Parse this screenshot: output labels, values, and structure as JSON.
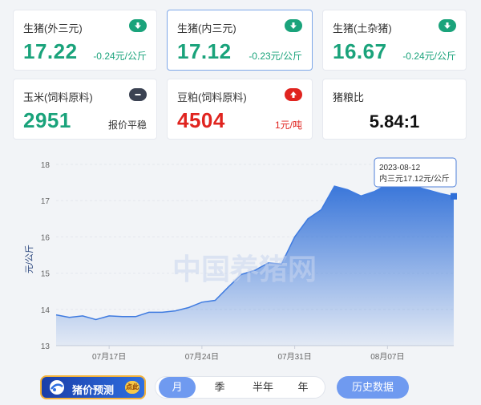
{
  "cards": [
    {
      "title": "生猪(外三元)",
      "value": "17.22",
      "change": "-0.24元/公斤",
      "trend": "down"
    },
    {
      "title": "生猪(内三元)",
      "value": "17.12",
      "change": "-0.23元/公斤",
      "trend": "down"
    },
    {
      "title": "生猪(土杂猪)",
      "value": "16.67",
      "change": "-0.24元/公斤",
      "trend": "down"
    },
    {
      "title": "玉米(饲料原料)",
      "value": "2951",
      "change": "报价平稳",
      "trend": "flat"
    },
    {
      "title": "豆粕(饲料原料)",
      "value": "4504",
      "change": "1元/吨",
      "trend": "up"
    },
    {
      "title": "猪粮比",
      "value": "5.84:1"
    }
  ],
  "colors": {
    "green": "#1aa37b",
    "red": "#e0241f",
    "blue": "#2f6fd8",
    "flat": "#3b4252"
  },
  "watermark": "中国养猪网",
  "tooltip": {
    "date": "2023-08-12",
    "text": "内三元17.12元/公斤"
  },
  "chart_data": {
    "type": "area",
    "ylabel": "元/公斤",
    "ylim": [
      13,
      18
    ],
    "yticks": [
      13,
      14,
      15,
      16,
      17,
      18
    ],
    "xtick_labels": [
      {
        "label": "07月17日",
        "x": 4
      },
      {
        "label": "07月24日",
        "x": 11
      },
      {
        "label": "07月31日",
        "x": 18
      },
      {
        "label": "08月07日",
        "x": 25
      }
    ],
    "x": [
      0,
      1,
      2,
      3,
      4,
      5,
      6,
      7,
      8,
      9,
      10,
      11,
      12,
      13,
      14,
      15,
      16,
      17,
      18,
      19,
      20,
      21,
      22,
      23,
      24,
      25,
      26,
      27,
      28,
      29,
      30
    ],
    "values": [
      13.85,
      13.78,
      13.82,
      13.72,
      13.82,
      13.8,
      13.8,
      13.92,
      13.92,
      13.96,
      14.05,
      14.2,
      14.25,
      14.62,
      14.97,
      15.08,
      15.28,
      15.25,
      16.0,
      16.5,
      16.75,
      17.4,
      17.3,
      17.13,
      17.25,
      17.45,
      17.4,
      17.4,
      17.3,
      17.2,
      17.12
    ],
    "grid": true
  },
  "bottom": {
    "predict_label": "猪价预测",
    "predict_badge": "点此",
    "periods": [
      "月",
      "季",
      "半年",
      "年"
    ],
    "active_period": "月",
    "history_label": "历史数据"
  }
}
